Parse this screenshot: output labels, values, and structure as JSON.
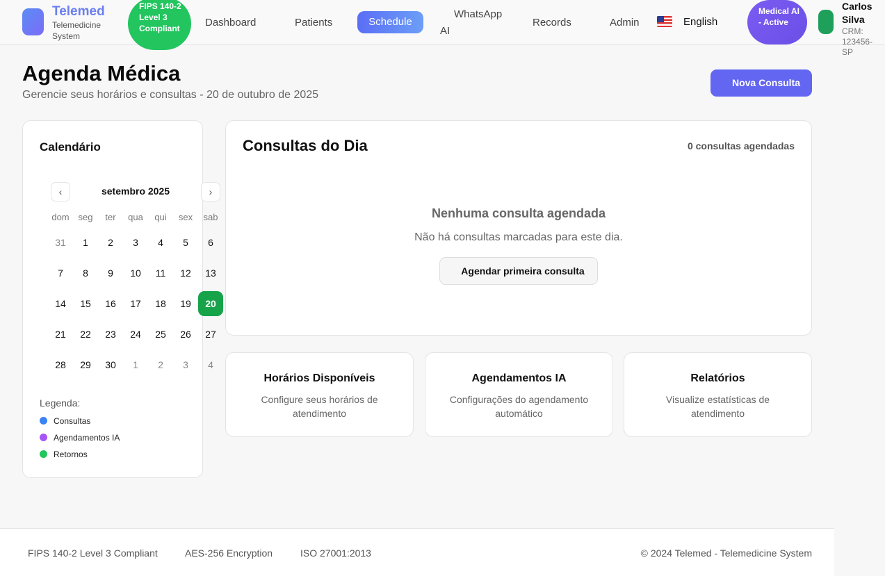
{
  "header": {
    "brand": {
      "name": "Telemed",
      "subtitle": "Telemedicine System"
    },
    "compliance_badge": "FIPS 140-2 Level 3 Compliant",
    "nav": {
      "dashboard": "Dashboard",
      "patients": "Patients",
      "schedule": "Schedule",
      "whatsapp_ai_line1": "WhatsApp",
      "whatsapp_ai_line2": "AI",
      "records": "Records",
      "admin": "Admin"
    },
    "language": "English",
    "ai_badge": "Medical AI - Active",
    "user": {
      "name": "Carlos Silva",
      "crm": "CRM: 123456-SP"
    }
  },
  "page": {
    "title": "Agenda Médica",
    "subtitle": "Gerencie seus horários e consultas - 20 de outubro de 2025",
    "new_button": "Nova Consulta"
  },
  "calendar": {
    "title": "Calendário",
    "prev_icon": "‹",
    "next_icon": "›",
    "month_label": "setembro 2025",
    "weekdays": [
      "dom",
      "seg",
      "ter",
      "qua",
      "qui",
      "sex",
      "sab"
    ],
    "weeks": [
      [
        "31",
        "1",
        "2",
        "3",
        "4",
        "5",
        "6"
      ],
      [
        "7",
        "8",
        "9",
        "10",
        "11",
        "12",
        "13"
      ],
      [
        "14",
        "15",
        "16",
        "17",
        "18",
        "19",
        "20"
      ],
      [
        "21",
        "22",
        "23",
        "24",
        "25",
        "26",
        "27"
      ],
      [
        "28",
        "29",
        "30",
        "1",
        "2",
        "3",
        "4"
      ]
    ],
    "selected_day": "20",
    "legend_title": "Legenda:",
    "legend": [
      {
        "label": "Consultas",
        "color": "#3b82f6"
      },
      {
        "label": "Agendamentos IA",
        "color": "#a855f7"
      },
      {
        "label": "Retornos",
        "color": "#22c55e"
      }
    ]
  },
  "consultations": {
    "title": "Consultas do Dia",
    "count_label": "0 consultas agendadas",
    "empty_title": "Nenhuma consulta agendada",
    "empty_sub": "Não há consultas marcadas para este dia.",
    "first_button": "Agendar primeira consulta"
  },
  "cards": [
    {
      "title": "Horários Disponíveis",
      "sub": "Configure seus horários de atendimento"
    },
    {
      "title": "Agendamentos IA",
      "sub": "Configurações do agendamento automático"
    },
    {
      "title": "Relatórios",
      "sub": "Visualize estatísticas de atendimento"
    }
  ],
  "footer": {
    "fips": "FIPS 140-2 Level 3 Compliant",
    "aes": "AES-256 Encryption",
    "iso": "ISO 27001:2013",
    "copyright": "© 2024 Telemed - Telemedicine System"
  },
  "colors": {
    "accent": "#6366f1",
    "selected_day": "#16a34a",
    "compliance": "#22c55e",
    "ai_badge": "#7c5cf2"
  }
}
